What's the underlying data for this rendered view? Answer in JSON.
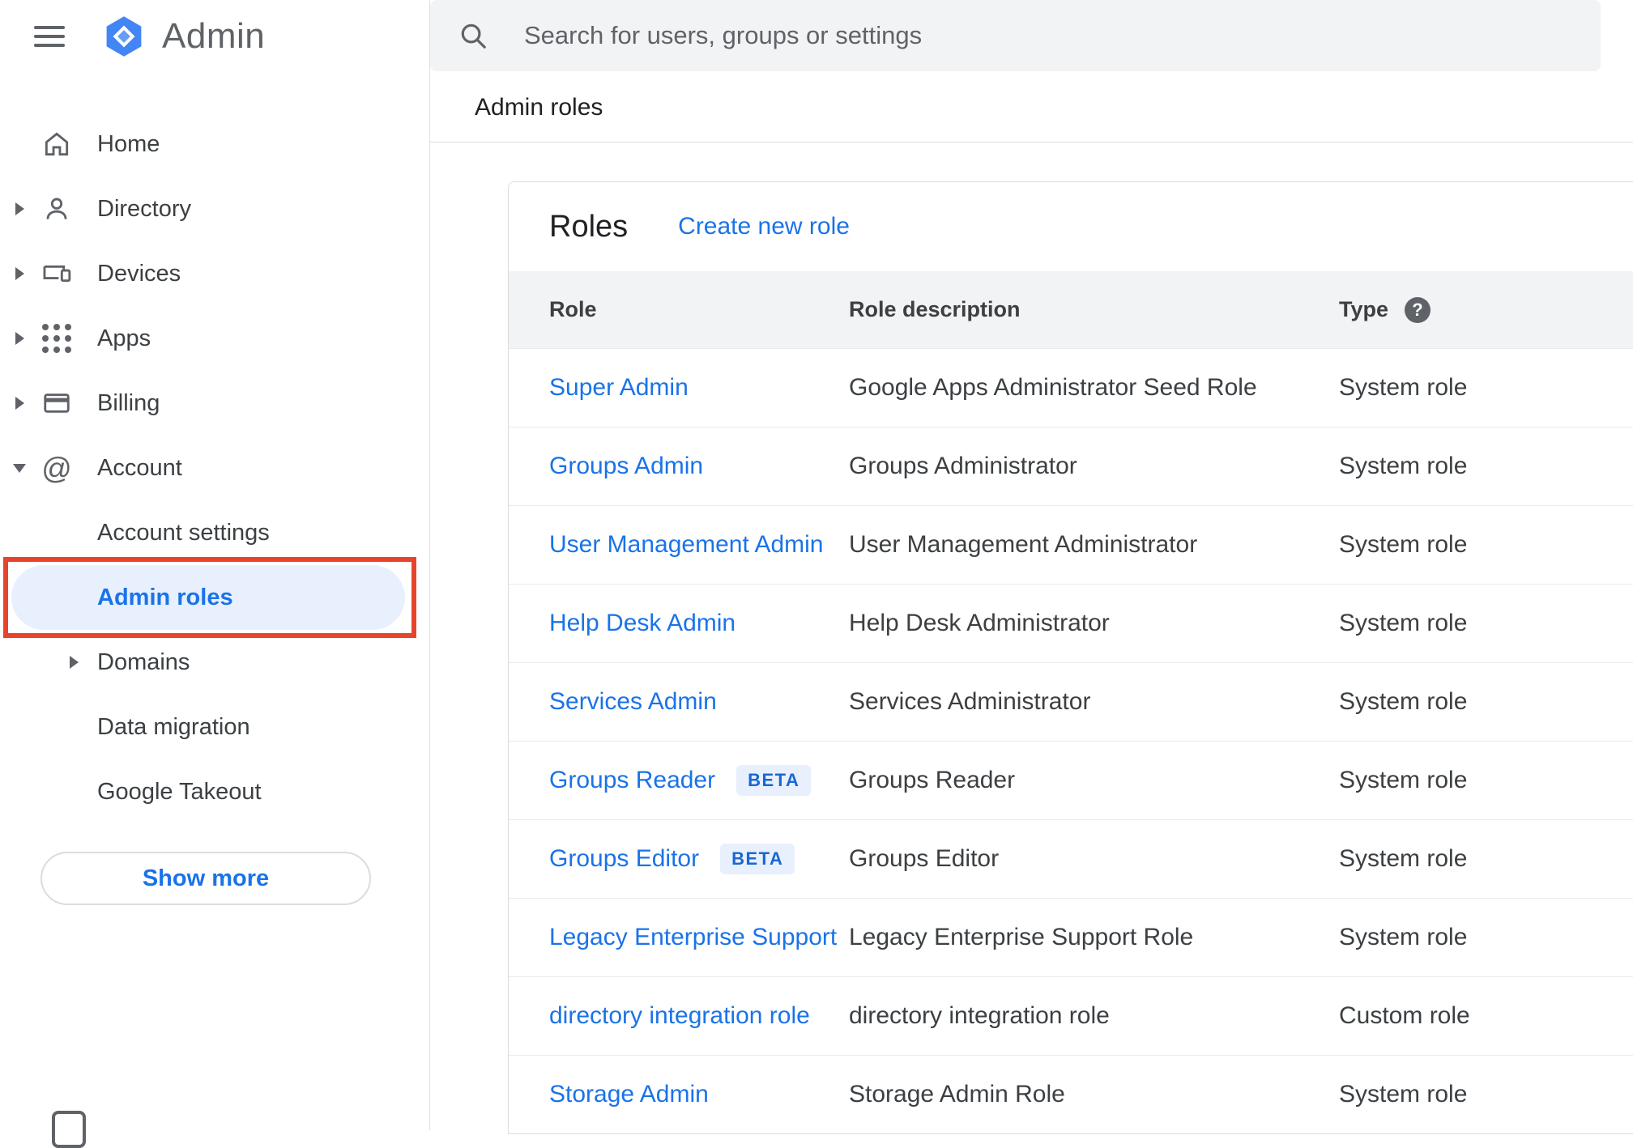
{
  "header": {
    "app_name": "Admin",
    "search_placeholder": "Search for users, groups or settings",
    "breadcrumb": "Admin roles"
  },
  "sidebar": {
    "items": [
      {
        "label": "Home",
        "icon": "home-icon"
      },
      {
        "label": "Directory",
        "icon": "person-icon"
      },
      {
        "label": "Devices",
        "icon": "devices-icon"
      },
      {
        "label": "Apps",
        "icon": "apps-grid-icon"
      },
      {
        "label": "Billing",
        "icon": "credit-card-icon"
      },
      {
        "label": "Account",
        "icon": "at-sign-icon"
      },
      {
        "label": "Account settings"
      },
      {
        "label": "Admin roles",
        "selected": true
      },
      {
        "label": "Domains"
      },
      {
        "label": "Data migration"
      },
      {
        "label": "Google Takeout"
      }
    ],
    "show_more_label": "Show more"
  },
  "main": {
    "card_title": "Roles",
    "create_link_label": "Create new role",
    "table": {
      "columns": [
        "Role",
        "Role description",
        "Type"
      ],
      "rows": [
        {
          "role": "Super Admin",
          "description": "Google Apps Administrator Seed Role",
          "type": "System role"
        },
        {
          "role": "Groups Admin",
          "description": "Groups Administrator",
          "type": "System role"
        },
        {
          "role": "User Management Admin",
          "description": "User Management Administrator",
          "type": "System role"
        },
        {
          "role": "Help Desk Admin",
          "description": "Help Desk Administrator",
          "type": "System role"
        },
        {
          "role": "Services Admin",
          "description": "Services Administrator",
          "type": "System role"
        },
        {
          "role": "Groups Reader",
          "badge": "BETA",
          "description": "Groups Reader",
          "type": "System role"
        },
        {
          "role": "Groups Editor",
          "badge": "BETA",
          "description": "Groups Editor",
          "type": "System role"
        },
        {
          "role": "Legacy Enterprise Support",
          "description": "Legacy Enterprise Support Role",
          "type": "System role"
        },
        {
          "role": "directory integration role",
          "description": "directory integration role",
          "type": "Custom role"
        },
        {
          "role": "Storage Admin",
          "description": "Storage Admin Role",
          "type": "System role"
        }
      ]
    }
  },
  "colors": {
    "accent_blue": "#1a73e8",
    "selected_item_bg": "#e8f0fe",
    "annotation_red": "#e8442c",
    "table_header_bg": "#f1f3f4"
  }
}
